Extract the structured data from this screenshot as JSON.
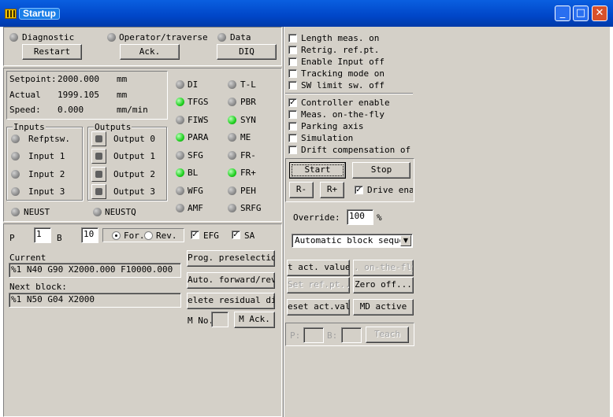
{
  "window": {
    "title": "Startup",
    "minimize_symbol": "_",
    "maximize_symbol": "□",
    "close_symbol": "✕"
  },
  "top_status": {
    "diagnostic": "Diagnostic",
    "operator": "Operator/traverse",
    "data": "Data",
    "restart_btn": "Restart",
    "ack_btn": "Ack.",
    "diq_btn": "DIQ"
  },
  "position": {
    "setpoint_label": "Setpoint:",
    "setpoint_value": "2000.000",
    "setpoint_unit": "mm",
    "actual_label": "Actual",
    "actual_value": "1999.105",
    "actual_unit": "mm",
    "speed_label": "Speed:",
    "speed_value": "0.000",
    "speed_unit": "mm/min"
  },
  "inputs": {
    "title": "Inputs",
    "items": [
      "Refptsw.",
      "Input 1",
      "Input 2",
      "Input 3"
    ]
  },
  "outputs": {
    "title": "Outputs",
    "items": [
      "Output 0",
      "Output 1",
      "Output 2",
      "Output 3"
    ]
  },
  "neust": "NEUST",
  "neustq": "NEUSTQ",
  "status_leds": {
    "left": [
      {
        "label": "DI",
        "on": false
      },
      {
        "label": "TFGS",
        "on": true
      },
      {
        "label": "FIWS",
        "on": false
      },
      {
        "label": "PARA",
        "on": true
      },
      {
        "label": "SFG",
        "on": false
      },
      {
        "label": "BL",
        "on": true
      },
      {
        "label": "WFG",
        "on": false
      },
      {
        "label": "AMF",
        "on": false
      }
    ],
    "right": [
      {
        "label": "T-L",
        "on": false
      },
      {
        "label": "PBR",
        "on": false
      },
      {
        "label": "SYN",
        "on": true
      },
      {
        "label": "ME",
        "on": false
      },
      {
        "label": "FR-",
        "on": false
      },
      {
        "label": "FR+",
        "on": true
      },
      {
        "label": "PEH",
        "on": false
      },
      {
        "label": "SRFG",
        "on": false
      }
    ]
  },
  "program": {
    "p_label": "P",
    "p_value": "1",
    "b_label": "B",
    "b_value": "10",
    "dir_for": "For.",
    "dir_rev": "Rev.",
    "efg": "EFG",
    "sa": "SA",
    "current_label": "Current",
    "current_block": "%1 N40 G90 X2000.000 F10000.000",
    "next_label": "Next block:",
    "next_block": "%1 N50 G04 X2000",
    "prog_presel_btn": "Prog. preselection",
    "auto_fwd_btn": "Auto. forward/rev",
    "delete_btn": "elete residual dist",
    "m_no_label": "M No.",
    "m_ack_btn": "M Ack."
  },
  "checkboxes": [
    {
      "label": "Length meas. on",
      "checked": false
    },
    {
      "label": "Retrig. ref.pt.",
      "checked": false
    },
    {
      "label": "Enable Input off",
      "checked": false
    },
    {
      "label": "Tracking mode on",
      "checked": false
    },
    {
      "label": "SW limit sw. off",
      "checked": false
    },
    {
      "label": "Controller enable",
      "checked": true
    },
    {
      "label": "Meas. on-the-fly",
      "checked": false
    },
    {
      "label": "Parking axis",
      "checked": false
    },
    {
      "label": "Simulation",
      "checked": false
    },
    {
      "label": "Drift compensation of",
      "checked": false
    }
  ],
  "control": {
    "start_btn": "Start",
    "stop_btn": "Stop",
    "r_minus_btn": "R-",
    "r_plus_btn": "R+",
    "drive_enable": "Drive enal",
    "override_label": "Override:",
    "override_value": "100",
    "override_unit": "%",
    "mode_select": "Automatic block sequen",
    "act_value_btn": "t act. value.",
    "on_the_fly_btn": ". on-the-fly",
    "set_ref_btn": "Set ref.pt...",
    "zero_off_btn": "Zero off...",
    "reset_act_btn": "eset act.val.",
    "md_active_btn": "MD active",
    "p_label": "P:",
    "b_label": "B:",
    "teach_btn": "Teach"
  }
}
